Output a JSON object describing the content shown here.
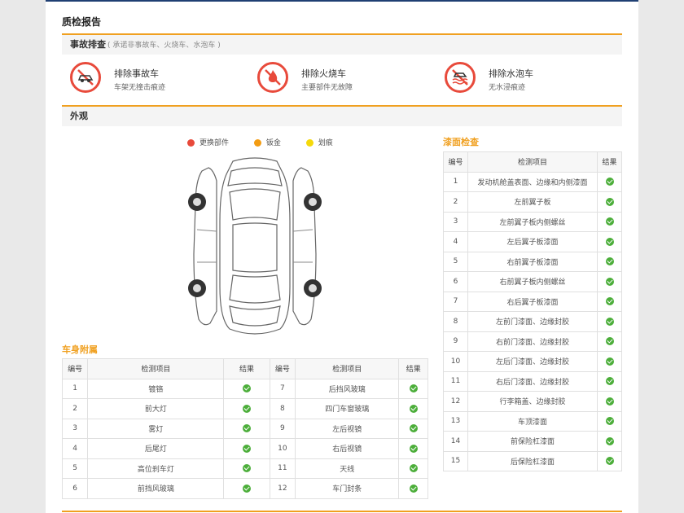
{
  "page": {
    "title": "质检报告"
  },
  "accident": {
    "header": "事故排查",
    "subtitle": "( 承诺非事故车、火烧车、水泡车 )",
    "items": [
      {
        "title": "排除事故车",
        "desc": "车架无撞击痕迹",
        "icon": "no-accident-car-icon"
      },
      {
        "title": "排除火烧车",
        "desc": "主要部件无故障",
        "icon": "no-fire-icon"
      },
      {
        "title": "排除水泡车",
        "desc": "无水浸痕迹",
        "icon": "no-flood-icon"
      }
    ]
  },
  "appearance": {
    "header": "外观",
    "legend": [
      {
        "label": "更换部件",
        "color": "#e84a3b"
      },
      {
        "label": "钣金",
        "color": "#f39c12"
      },
      {
        "label": "划痕",
        "color": "#f5d90a"
      }
    ]
  },
  "paint": {
    "title": "漆面检查",
    "headers": [
      "编号",
      "检测项目",
      "结果"
    ],
    "rows": [
      [
        "1",
        "发动机舱盖表面、边缘和内侧漆面"
      ],
      [
        "2",
        "左前翼子板"
      ],
      [
        "3",
        "左前翼子板内侧螺丝"
      ],
      [
        "4",
        "左后翼子板漆面"
      ],
      [
        "5",
        "右前翼子板漆面"
      ],
      [
        "6",
        "右前翼子板内侧螺丝"
      ],
      [
        "7",
        "右后翼子板漆面"
      ],
      [
        "8",
        "左前门漆面、边缘封胶"
      ],
      [
        "9",
        "右前门漆面、边缘封胶"
      ],
      [
        "10",
        "左后门漆面、边缘封胶"
      ],
      [
        "11",
        "右后门漆面、边缘封胶"
      ],
      [
        "12",
        "行李箱盖、边缘封胶"
      ],
      [
        "13",
        "车顶漆面"
      ],
      [
        "14",
        "前保险杠漆面"
      ],
      [
        "15",
        "后保险杠漆面"
      ]
    ]
  },
  "body_parts": {
    "title": "车身附属",
    "headers": [
      "编号",
      "检测项目",
      "结果",
      "编号",
      "检测项目",
      "结果"
    ],
    "rows": [
      [
        "1",
        "镀铬",
        "7",
        "后挡风玻璃"
      ],
      [
        "2",
        "前大灯",
        "8",
        "四门车窗玻璃"
      ],
      [
        "3",
        "雾灯",
        "9",
        "左后视镜"
      ],
      [
        "4",
        "后尾灯",
        "10",
        "右后视镜"
      ],
      [
        "5",
        "高位刹车灯",
        "11",
        "天线"
      ],
      [
        "6",
        "前挡风玻璃",
        "12",
        "车门封条"
      ]
    ]
  },
  "colors": {
    "accent": "#f0a020",
    "ok": "#4cae3a",
    "warn_red": "#e84a3b",
    "top_border": "#1f3f73"
  }
}
